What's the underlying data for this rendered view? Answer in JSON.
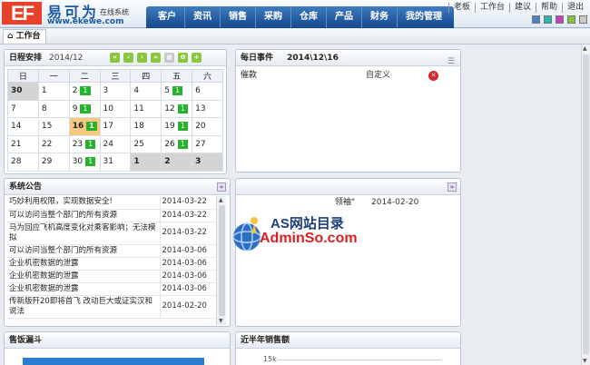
{
  "brand": {
    "mark": "EF",
    "name_cn": "易可为",
    "tagline": "在线系统",
    "url": "www.ekewe.com"
  },
  "nav": {
    "items": [
      "客户",
      "资讯",
      "销售",
      "采购",
      "仓库",
      "产品",
      "财务",
      "我的管理"
    ]
  },
  "utils": {
    "items": [
      "老板",
      "工作台",
      "建议",
      "帮助",
      "退出"
    ]
  },
  "skins": [
    "#4a7fc1",
    "#2ab7a9",
    "#c23fbf",
    "#86c440",
    "#c9c9c9"
  ],
  "tab": {
    "home_label": "工作台"
  },
  "calendar": {
    "title": "日程安排",
    "month": "2014/12",
    "weekdays": [
      "日",
      "一",
      "二",
      "三",
      "四",
      "五",
      "六"
    ],
    "weeks": [
      [
        {
          "d": "30",
          "dim": true
        },
        {
          "d": "1"
        },
        {
          "d": "2",
          "n": "1"
        },
        {
          "d": "3"
        },
        {
          "d": "4"
        },
        {
          "d": "5",
          "n": "1"
        },
        {
          "d": "6"
        }
      ],
      [
        {
          "d": "7"
        },
        {
          "d": "8"
        },
        {
          "d": "9",
          "n": "1"
        },
        {
          "d": "10"
        },
        {
          "d": "11"
        },
        {
          "d": "12",
          "n": "1"
        },
        {
          "d": "13"
        }
      ],
      [
        {
          "d": "14"
        },
        {
          "d": "15"
        },
        {
          "d": "16",
          "n": "1",
          "today": true
        },
        {
          "d": "17"
        },
        {
          "d": "18"
        },
        {
          "d": "19",
          "n": "1"
        },
        {
          "d": "20"
        }
      ],
      [
        {
          "d": "21"
        },
        {
          "d": "22"
        },
        {
          "d": "23",
          "n": "1"
        },
        {
          "d": "24"
        },
        {
          "d": "25"
        },
        {
          "d": "26",
          "n": "1"
        },
        {
          "d": "27"
        }
      ],
      [
        {
          "d": "28"
        },
        {
          "d": "29"
        },
        {
          "d": "30",
          "n": "1"
        },
        {
          "d": "31"
        },
        {
          "d": "1",
          "dim": true
        },
        {
          "d": "2",
          "dim": true
        },
        {
          "d": "3",
          "dim": true
        }
      ]
    ]
  },
  "events": {
    "title": "每日事件",
    "date": "2014\\12\\16",
    "rows": [
      {
        "name": "催款",
        "type": "自定义"
      }
    ]
  },
  "notices": {
    "title": "系统公告",
    "rows": [
      {
        "t": "巧妙利用权限，实现数据安全!",
        "d": "2014-03-22"
      },
      {
        "t": "可以访问当整个部门的所有资源",
        "d": "2014-03-22"
      },
      {
        "t": "马为回应飞机高度变化对乘客影响；无法模拟",
        "d": "2014-03-22",
        "tall": true
      },
      {
        "t": "可以访问当整个部门的所有资源",
        "d": "2014-03-06"
      },
      {
        "t": "企业机密数据的泄露",
        "d": "2014-03-06"
      },
      {
        "t": "企业机密数据的泄露",
        "d": "2014-03-06"
      },
      {
        "t": "企业机密数据的泄露",
        "d": "2014-03-06"
      },
      {
        "t": "传新版歼20即将首飞 改动巨大或证实汉和说法",
        "d": "2014-02-20",
        "tall": true
      }
    ]
  },
  "mid": {
    "partial_text": "领袖\"",
    "date": "2014-02-20"
  },
  "watermark": {
    "title": "AS网站目录",
    "url": "AdminSo.com"
  },
  "funnel": {
    "title": "售饭漏斗"
  },
  "sales": {
    "title": "近半年销售额",
    "tick": "15k"
  }
}
